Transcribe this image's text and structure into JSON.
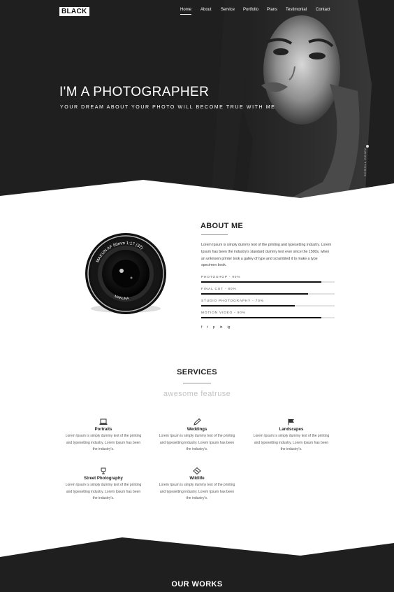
{
  "brand": {
    "logo": "BLACK"
  },
  "nav": [
    {
      "label": "Home",
      "active": true
    },
    {
      "label": "About"
    },
    {
      "label": "Service"
    },
    {
      "label": "Portfolio"
    },
    {
      "label": "Plans"
    },
    {
      "label": "Testimonial"
    },
    {
      "label": "Contact"
    }
  ],
  "hero": {
    "title": "I'M A PHOTOGRAPHER",
    "subtitle": "YOUR DREAM ABOUT YOUR PHOTO WILL BECOME TRUE WITH ME",
    "scroll_label": "SCROLL DOWN"
  },
  "about": {
    "title": "ABOUT ME",
    "text": "Lorem Ipsum is simply dummy text of the printing and typesetting industry. Lorem Ipsum has been the industry's standard dummy text ever since the 1500s, when an unknown printer took a galley of type and scrambled it to make a type specimen book.",
    "skills": [
      {
        "label": "PHOTOSHOP - 90%",
        "value": 0.9
      },
      {
        "label": "FINAL CUT - 80%",
        "value": 0.8
      },
      {
        "label": "STUDIO PHOTOGRAPHY - 70%",
        "value": 0.7
      },
      {
        "label": "MOTION VIDEO - 90%",
        "value": 0.9
      }
    ],
    "social": [
      "f",
      "t",
      "p",
      "in",
      "ig"
    ],
    "lens_text": [
      "MAKUN AF 50mm 1:17 (32)",
      "MAKUNA"
    ]
  },
  "services": {
    "title": "SERVICES",
    "subtitle": "awesome featruse",
    "items": [
      {
        "name": "Portraits",
        "icon": "laptop-icon",
        "desc": "Lorem Ipsum is simply dummy text of the printing and typesetting industry. Lorem Ipsum has been the industry's."
      },
      {
        "name": "Weddings",
        "icon": "pencil-icon",
        "desc": "Lorem Ipsum is simply dummy text of the printing and typesetting industry. Lorem Ipsum has been the industry's."
      },
      {
        "name": "Landscapes",
        "icon": "flag-icon",
        "desc": "Lorem Ipsum is simply dummy text of the printing and typesetting industry. Lorem Ipsum has been the industry's."
      },
      {
        "name": "Street Photography",
        "icon": "trophy-icon",
        "desc": "Lorem Ipsum is simply dummy text of the printing and typesetting industry. Lorem Ipsum has been the industry's."
      },
      {
        "name": "Wildlife",
        "icon": "ticket-icon",
        "desc": "Lorem Ipsum is simply dummy text of the printing and typesetting industry. Lorem Ipsum has been the industry's."
      }
    ]
  },
  "works": {
    "title": "OUR WORKS"
  },
  "colors": {
    "dark": "#1f1f1f",
    "accent": "#111111",
    "muted": "#c4c4c4"
  }
}
